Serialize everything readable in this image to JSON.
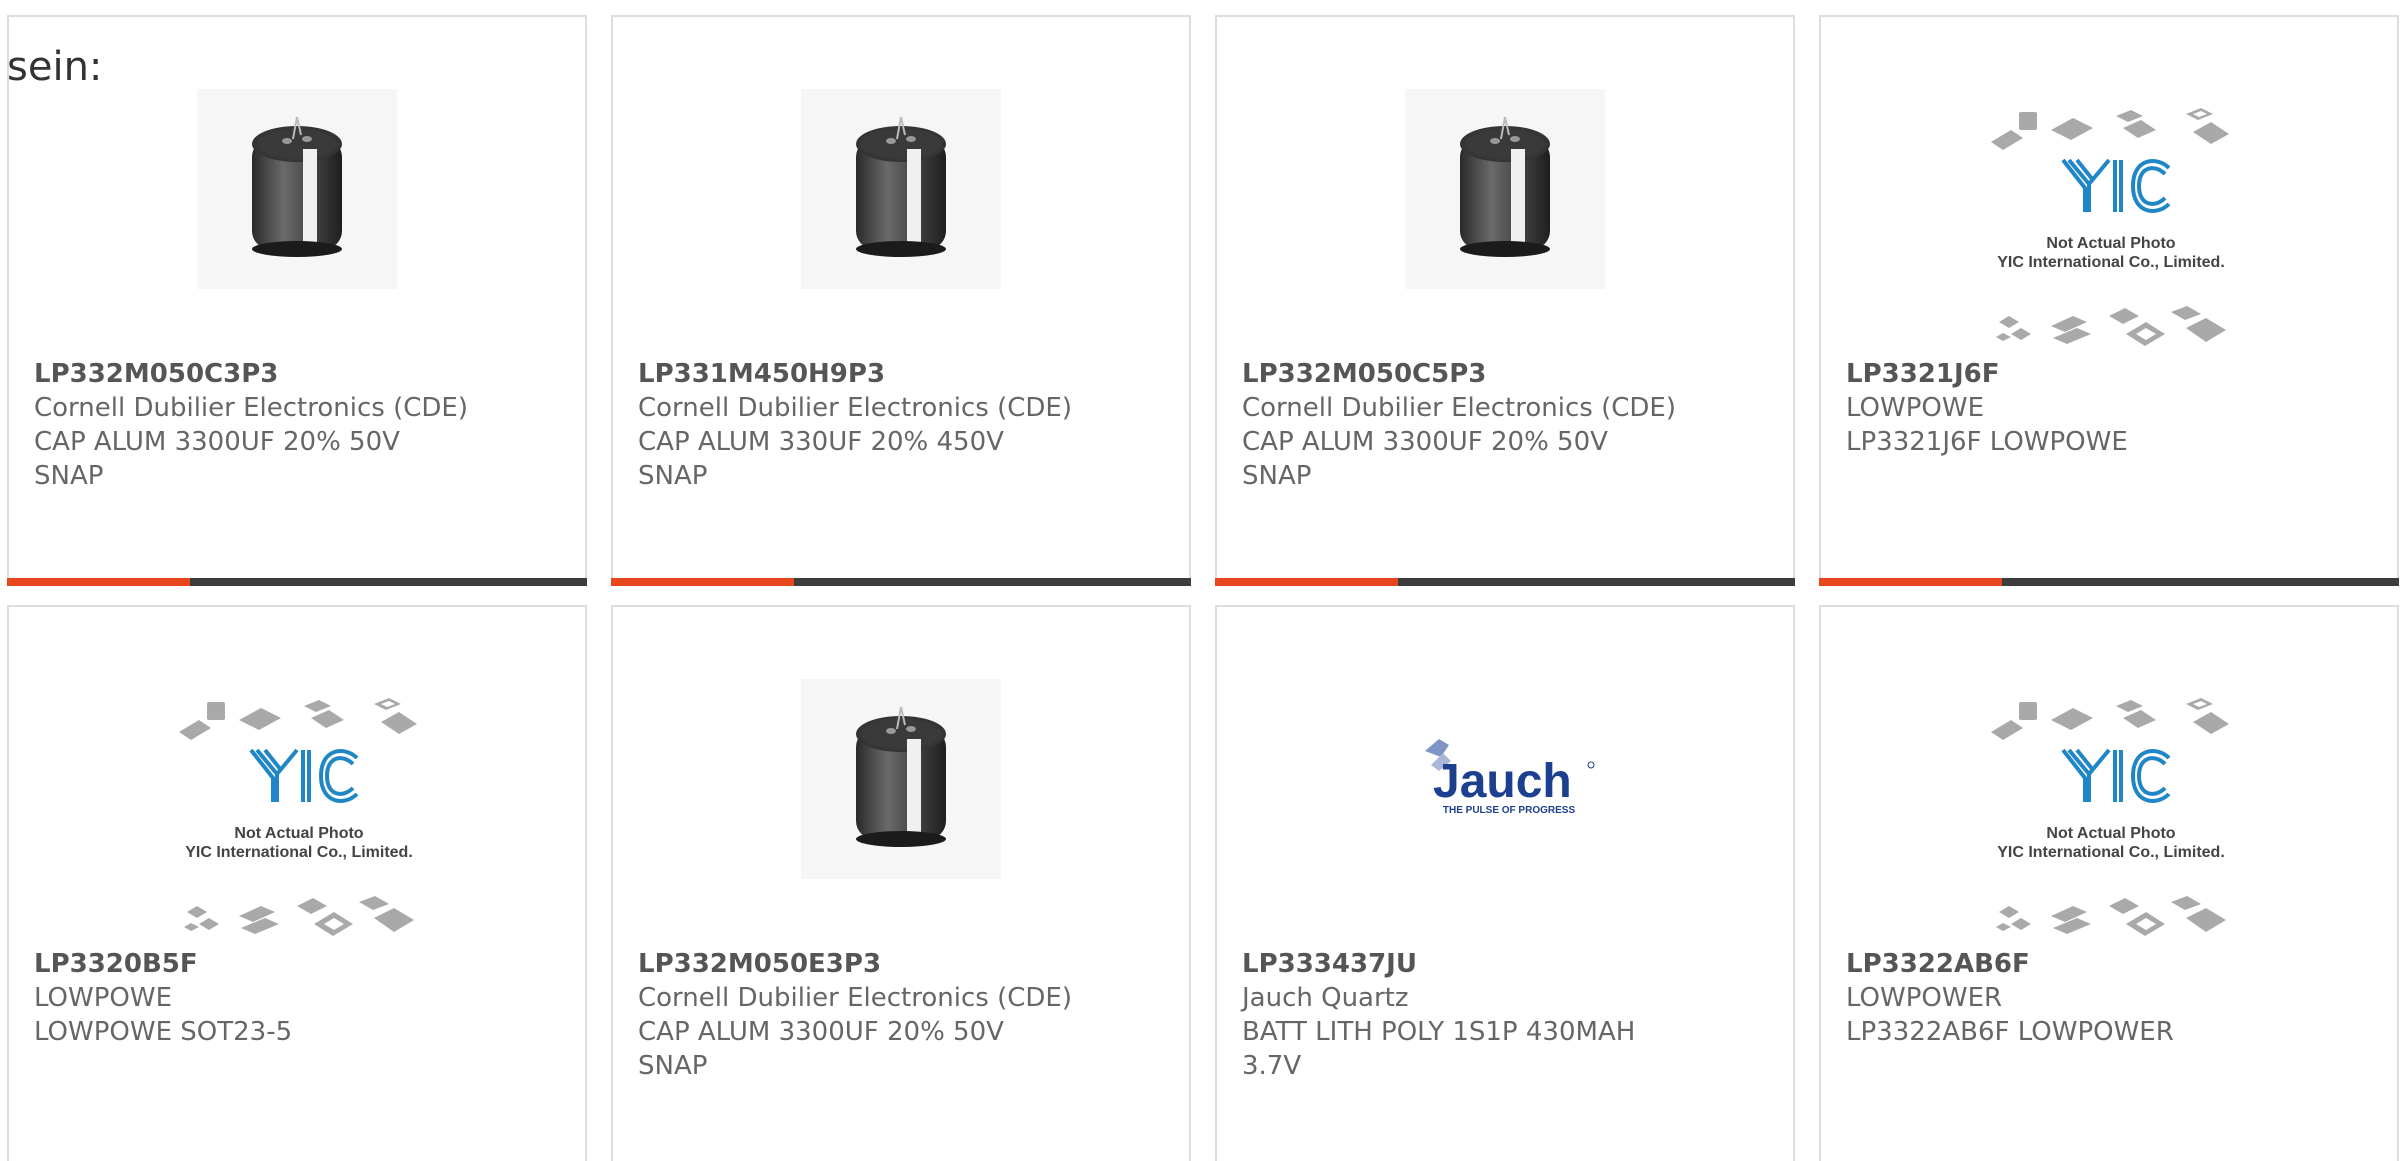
{
  "intro_text": "sein:",
  "colors": {
    "accent": "#e8461c",
    "bar": "#3d3d3d",
    "yic_blue": "#1f86c7",
    "jauch_blue": "#1d3f8f"
  },
  "placeholder_text": {
    "line1": "Not Actual Photo",
    "line2": "YIC International Co., Limited."
  },
  "jauch_logo": {
    "word": "Jauch",
    "tagline": "THE PULSE OF PROGRESS"
  },
  "products": [
    {
      "part_number": "LP332M050C3P3",
      "manufacturer": "Cornell Dubilier Electronics (CDE)",
      "desc1": "CAP ALUM 3300UF 20% 50V",
      "desc2": "SNAP",
      "image": "capacitor-photo"
    },
    {
      "part_number": "LP331M450H9P3",
      "manufacturer": "Cornell Dubilier Electronics (CDE)",
      "desc1": "CAP ALUM 330UF 20% 450V",
      "desc2": "SNAP",
      "image": "capacitor-photo"
    },
    {
      "part_number": "LP332M050C5P3",
      "manufacturer": "Cornell Dubilier Electronics (CDE)",
      "desc1": "CAP ALUM 3300UF 20% 50V",
      "desc2": "SNAP",
      "image": "capacitor-photo"
    },
    {
      "part_number": "LP3321J6F",
      "manufacturer": "LOWPOWE",
      "desc1": "LP3321J6F LOWPOWE",
      "desc2": "",
      "image": "not-actual-photo"
    },
    {
      "part_number": "LP3320B5F",
      "manufacturer": "LOWPOWE",
      "desc1": "LOWPOWE SOT23-5",
      "desc2": "",
      "image": "not-actual-photo"
    },
    {
      "part_number": "LP332M050E3P3",
      "manufacturer": "Cornell Dubilier Electronics (CDE)",
      "desc1": "CAP ALUM 3300UF 20% 50V",
      "desc2": "SNAP",
      "image": "capacitor-photo"
    },
    {
      "part_number": "LP333437JU",
      "manufacturer": "Jauch Quartz",
      "desc1": "BATT LITH POLY 1S1P 430MAH",
      "desc2": "3.7V",
      "image": "jauch-logo"
    },
    {
      "part_number": "LP3322AB6F",
      "manufacturer": "LOWPOWER",
      "desc1": "LP3322AB6F LOWPOWER",
      "desc2": "",
      "image": "not-actual-photo"
    }
  ]
}
